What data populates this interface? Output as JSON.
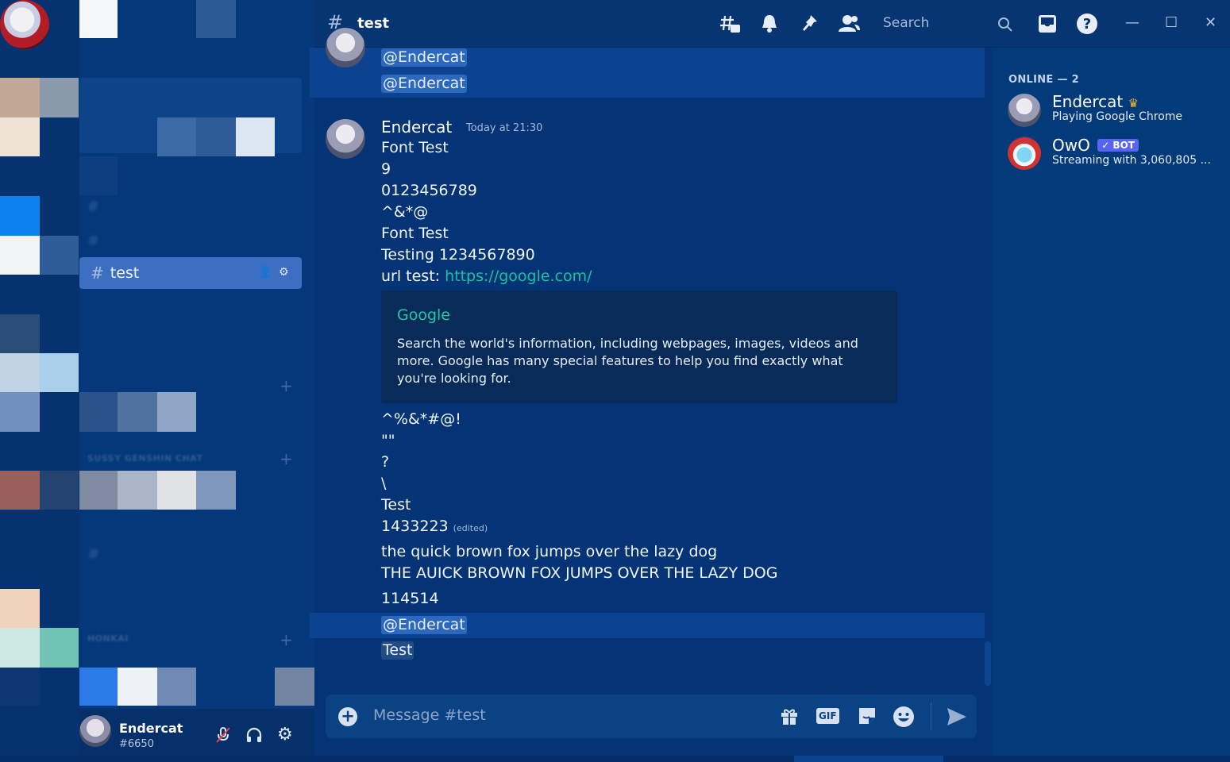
{
  "channel": {
    "name": "test",
    "hash": "#"
  },
  "topbar": {
    "search_placeholder": "Search"
  },
  "sidebar": {
    "active_channel": "test",
    "visible_categories": [
      "SUSSY GENSHIN CHAT",
      "HONKAI"
    ]
  },
  "user_panel": {
    "name": "Endercat",
    "tag": "#6650"
  },
  "chat": {
    "top_mentions": [
      "@Endercat",
      "@Endercat"
    ],
    "author": "Endercat",
    "timestamp": "Today at 21:30",
    "lines_a": [
      "Font Test",
      "9",
      "0123456789",
      "^&*@",
      "Font Test",
      "Testing 1234567890"
    ],
    "url_prefix": "url test: ",
    "url": "https://google.com/",
    "embed": {
      "title": "Google",
      "description": "Search the world's information, including webpages, images, videos and more. Google has many special features to help you find exactly what you're looking for."
    },
    "lines_b": [
      "^%&*#@!",
      "\"\"",
      "?",
      "\\",
      "Test"
    ],
    "edited_line": "1433223",
    "edited_label": "(edited)",
    "lines_c": [
      "the quick brown fox jumps over the lazy dog",
      "THE AUICK BROWN FOX JUMPS OVER THE LAZY DOG",
      "114514"
    ],
    "bottom_mention": "@Endercat",
    "last_line": "Test"
  },
  "composer": {
    "placeholder": "Message #test",
    "gif_label": "GIF"
  },
  "members": {
    "header": "ONLINE — 2",
    "list": [
      {
        "name": "Endercat",
        "activity": "Playing Google Chrome",
        "owner": true
      },
      {
        "name": "OwO",
        "activity": "Streaming with 3,060,805 ...",
        "bot_label": "✓ BOT"
      }
    ]
  },
  "icons": [
    "threads-icon",
    "bell-icon",
    "pin-icon",
    "members-icon",
    "search-icon",
    "inbox-icon",
    "help-icon",
    "minimize-icon",
    "maximize-icon",
    "close-icon",
    "add-icon",
    "gift-icon",
    "sticker-icon",
    "emoji-icon",
    "send-icon",
    "mute-icon",
    "headphones-icon",
    "settings-icon",
    "invite-icon"
  ]
}
